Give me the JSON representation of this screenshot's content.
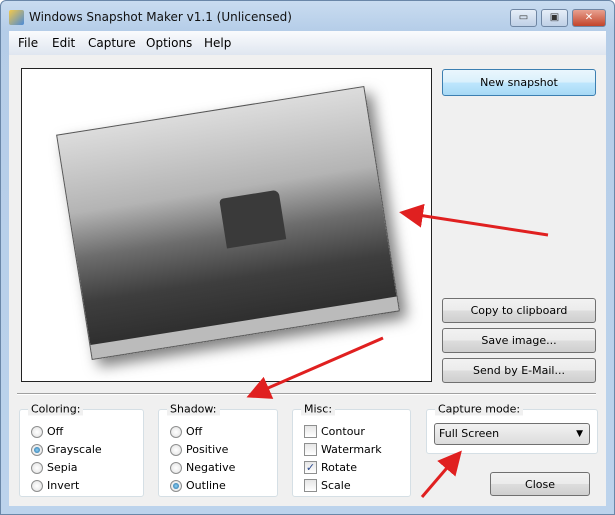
{
  "window": {
    "title": "Windows Snapshot Maker v1.1 (Unlicensed)",
    "minimize": "▭",
    "maximize": "▣",
    "close": "✕"
  },
  "menu": [
    "File",
    "Edit",
    "Capture",
    "Options",
    "Help"
  ],
  "buttons": {
    "new_snapshot": "New snapshot",
    "copy": "Copy to clipboard",
    "save": "Save image...",
    "email": "Send by E-Mail...",
    "close": "Close"
  },
  "coloring": {
    "label": "Coloring:",
    "options": [
      "Off",
      "Grayscale",
      "Sepia",
      "Invert"
    ],
    "selected": "Grayscale"
  },
  "shadow": {
    "label": "Shadow:",
    "options": [
      "Off",
      "Positive",
      "Negative",
      "Outline"
    ],
    "selected": "Outline"
  },
  "misc": {
    "label": "Misc:",
    "options": [
      {
        "label": "Contour",
        "checked": false
      },
      {
        "label": "Watermark",
        "checked": false
      },
      {
        "label": "Rotate",
        "checked": true
      },
      {
        "label": "Scale",
        "checked": false
      }
    ]
  },
  "capture_mode": {
    "label": "Capture mode:",
    "value": "Full Screen"
  },
  "annotation_color": "#e02020"
}
